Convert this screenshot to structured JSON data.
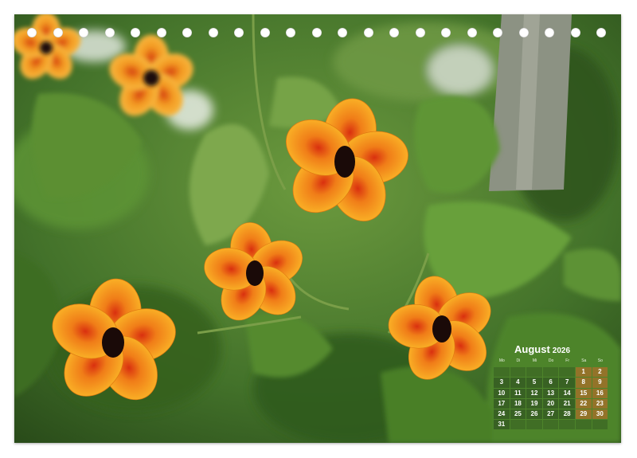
{
  "calendar": {
    "month": "August",
    "year": "2026",
    "weekdays": [
      "Mo",
      "Di",
      "Mi",
      "Do",
      "Fr",
      "Sa",
      "So"
    ],
    "weeks": [
      [
        "",
        "",
        "",
        "",
        "",
        "1",
        "2"
      ],
      [
        "3",
        "4",
        "5",
        "6",
        "7",
        "8",
        "9"
      ],
      [
        "10",
        "11",
        "12",
        "13",
        "14",
        "15",
        "16"
      ],
      [
        "17",
        "18",
        "19",
        "20",
        "21",
        "22",
        "23"
      ],
      [
        "24",
        "25",
        "26",
        "27",
        "28",
        "29",
        "30"
      ],
      [
        "31",
        "",
        "",
        "",
        "",
        "",
        ""
      ]
    ]
  },
  "photo": {
    "subject": "orange black-eyed susan vine flowers",
    "flower_color": "#f7a21b",
    "flower_center_color": "#1a0a08",
    "leaf_color": "#4f8a2e",
    "background_color": "#3f6b2a"
  },
  "binding": {
    "icon": "spiral-binding-holes"
  }
}
